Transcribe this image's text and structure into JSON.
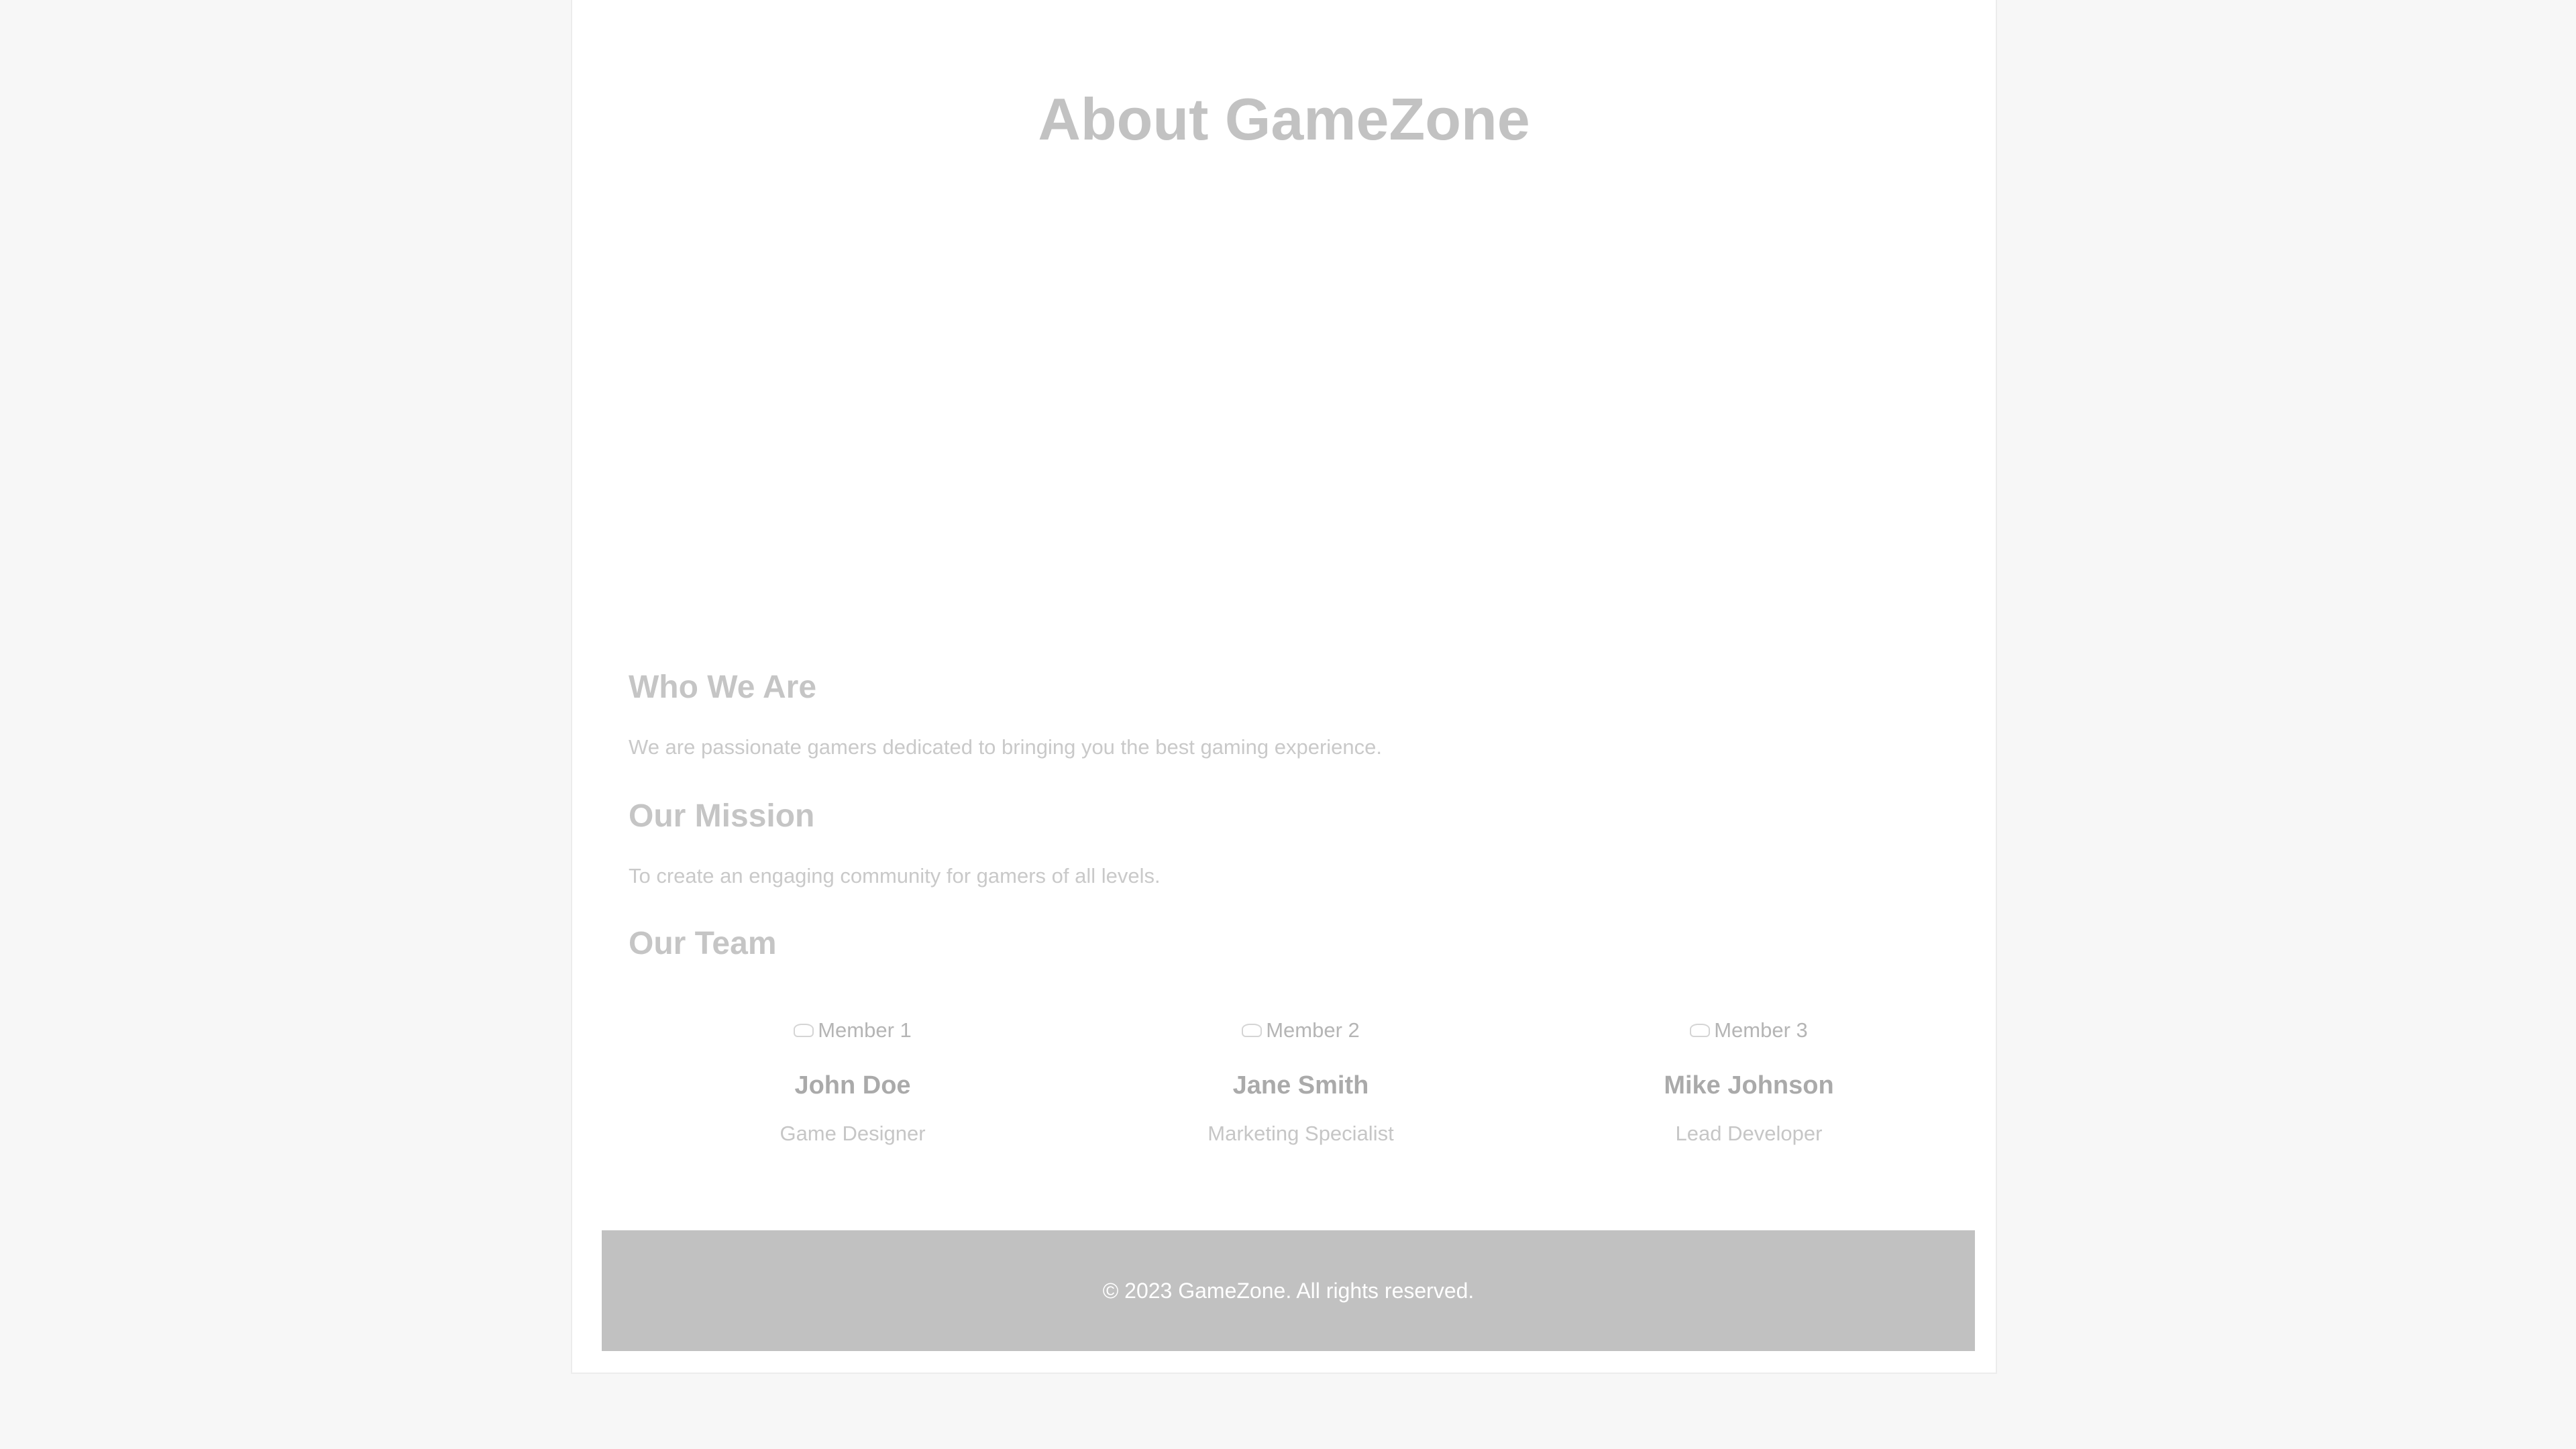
{
  "page": {
    "title": "About GameZone"
  },
  "sections": {
    "who_we_are": {
      "heading": "Who We Are",
      "text": "We are passionate gamers dedicated to bringing you the best gaming experience."
    },
    "mission": {
      "heading": "Our Mission",
      "text": "To create an engaging community for gamers of all levels."
    },
    "team": {
      "heading": "Our Team",
      "members": [
        {
          "image_alt": "Member 1",
          "name": "John Doe",
          "role": "Game Designer"
        },
        {
          "image_alt": "Member 2",
          "name": "Jane Smith",
          "role": "Marketing Specialist"
        },
        {
          "image_alt": "Member 3",
          "name": "Mike Johnson",
          "role": "Lead Developer"
        }
      ]
    }
  },
  "footer": {
    "text": "© 2023 GameZone. All rights reserved."
  }
}
